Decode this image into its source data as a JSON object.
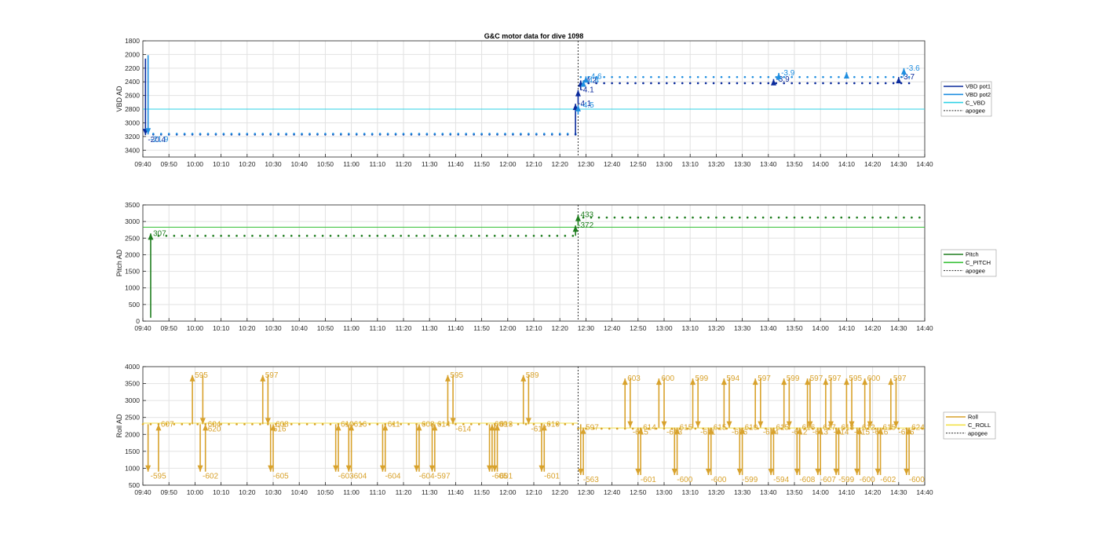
{
  "title": "G&C motor data for dive 1098",
  "colors": {
    "vbd_pot1": "#0a2a9c",
    "vbd_pot2": "#1f8ee0",
    "c_vbd": "#2ed2e6",
    "pitch": "#1e7d1e",
    "c_pitch": "#33c033",
    "roll": "#d8a22c",
    "c_roll": "#f2e24a",
    "apogee": "#333333",
    "grid": "#e2e2e2",
    "axis": "#262626"
  },
  "x_ticks": [
    "09:40",
    "09:50",
    "10:00",
    "10:10",
    "10:20",
    "10:30",
    "10:40",
    "10:50",
    "11:00",
    "11:10",
    "11:20",
    "11:30",
    "11:40",
    "11:50",
    "12:00",
    "12:10",
    "12:20",
    "12:30",
    "12:40",
    "12:50",
    "13:00",
    "13:10",
    "13:20",
    "13:30",
    "13:40",
    "13:50",
    "14:00",
    "14:10",
    "14:20",
    "14:30",
    "14:40"
  ],
  "chart_data": [
    {
      "type": "scatter",
      "title": "G&C motor data for dive 1098",
      "xlabel": "",
      "ylabel": "VBD AD",
      "xlim": [
        "09:40",
        "14:40"
      ],
      "ylim": [
        1800,
        3500
      ],
      "y_reversed": true,
      "y_ticks": [
        1800,
        2000,
        2200,
        2400,
        2600,
        2800,
        3000,
        3200,
        3400
      ],
      "grid": true,
      "legend": "right",
      "legend_entries": [
        "VBD pot1",
        "VBD pot2",
        "C_VBD",
        "apogee"
      ],
      "apogee_x": "12:27",
      "reference_lines": [
        {
          "name": "C_VBD",
          "y": 2800
        }
      ],
      "series": [
        {
          "name": "VBD pot1",
          "style": "dots",
          "x_range": [
            "09:44",
            "14:35"
          ],
          "segments": [
            {
              "from": "09:44",
              "to": "12:26",
              "y": 3170
            },
            {
              "from": "12:28",
              "to": "14:35",
              "y": 2420
            }
          ]
        },
        {
          "name": "VBD pot2",
          "style": "dots",
          "x_range": [
            "09:44",
            "14:35"
          ],
          "segments": [
            {
              "from": "09:44",
              "to": "12:26",
              "y": 3160
            },
            {
              "from": "12:28",
              "to": "14:35",
              "y": 2330
            }
          ]
        }
      ],
      "moves": [
        {
          "series": "VBD pot1",
          "x": "09:41",
          "from": 2060,
          "to": 3180,
          "label": "-20.4"
        },
        {
          "series": "VBD pot2",
          "x": "09:42",
          "from": 2010,
          "to": 3170,
          "label": "-21.9"
        },
        {
          "series": "VBD pot1",
          "x": "12:26",
          "from": 3180,
          "to": 2720,
          "label": "-4.1"
        },
        {
          "series": "VBD pot2",
          "x": "12:27",
          "from": 2880,
          "to": 2740,
          "label": "-4.5"
        },
        {
          "series": "VBD pot1",
          "x": "12:27",
          "from": 2720,
          "to": 2520,
          "label": "-4.1"
        },
        {
          "series": "VBD pot1",
          "x": "12:28",
          "from": 2520,
          "to": 2380,
          "label": "-4.2"
        },
        {
          "series": "VBD pot2",
          "x": "12:29",
          "from": 2440,
          "to": 2380,
          "label": "-4.4"
        },
        {
          "series": "VBD pot2",
          "x": "12:30",
          "from": 2380,
          "to": 2320,
          "label": "-4.6"
        },
        {
          "series": "VBD pot1",
          "x": "13:42",
          "from": 2420,
          "to": 2360,
          "label": "-3.9"
        },
        {
          "series": "VBD pot2",
          "x": "13:44",
          "from": 2380,
          "to": 2270,
          "label": "-3.9"
        },
        {
          "series": "VBD pot2",
          "x": "14:10",
          "from": 2310,
          "to": 2260,
          "label": ""
        },
        {
          "series": "VBD pot1",
          "x": "14:30",
          "from": 2400,
          "to": 2330,
          "label": "-3.7"
        },
        {
          "series": "VBD pot2",
          "x": "14:32",
          "from": 2320,
          "to": 2200,
          "label": "-3.6"
        }
      ]
    },
    {
      "type": "scatter",
      "xlabel": "",
      "ylabel": "Pitch AD",
      "xlim": [
        "09:40",
        "14:40"
      ],
      "ylim": [
        0,
        3500
      ],
      "y_ticks": [
        0,
        500,
        1000,
        1500,
        2000,
        2500,
        3000,
        3500
      ],
      "grid": true,
      "legend": "right",
      "legend_entries": [
        "Pitch",
        "C_PITCH",
        "apogee"
      ],
      "apogee_x": "12:27",
      "reference_lines": [
        {
          "name": "C_PITCH",
          "y": 2830
        }
      ],
      "series": [
        {
          "name": "Pitch",
          "style": "dots",
          "segments": [
            {
              "from": "09:43",
              "to": "12:25",
              "y": 2570
            },
            {
              "from": "12:29",
              "to": "14:40",
              "y": 3120
            }
          ]
        }
      ],
      "moves": [
        {
          "series": "Pitch",
          "x": "09:43",
          "from": 100,
          "to": 2640,
          "label": "307"
        },
        {
          "series": "Pitch",
          "x": "12:26",
          "from": 2570,
          "to": 2880,
          "label": "-372"
        },
        {
          "series": "Pitch",
          "x": "12:27",
          "from": 2880,
          "to": 3200,
          "label": "433"
        }
      ]
    },
    {
      "type": "scatter",
      "xlabel": "",
      "ylabel": "Roll AD",
      "xlim": [
        "09:40",
        "14:40"
      ],
      "ylim": [
        500,
        4000
      ],
      "y_ticks": [
        500,
        1000,
        1500,
        2000,
        2500,
        3000,
        3500,
        4000
      ],
      "grid": true,
      "legend": "right",
      "legend_entries": [
        "Roll",
        "C_ROLL",
        "apogee"
      ],
      "apogee_x": "12:27",
      "reference_lines": [
        {
          "name": "C_ROLL",
          "segments": [
            {
              "from": "09:40",
              "to": "12:27",
              "y": 2330
            },
            {
              "from": "12:27",
              "to": "14:40",
              "y": 2190
            }
          ]
        }
      ],
      "series": [
        {
          "name": "Roll",
          "style": "dots",
          "segments": [
            {
              "from": "09:40",
              "to": "12:27",
              "y": 2300
            },
            {
              "from": "12:27",
              "to": "14:40",
              "y": 2170
            }
          ]
        }
      ],
      "moves": [
        {
          "x": "09:42",
          "from": 2300,
          "to": 900,
          "label": "-595"
        },
        {
          "x": "09:46",
          "from": 900,
          "to": 2300,
          "label": "607"
        },
        {
          "x": "09:59",
          "from": 2300,
          "to": 3750,
          "label": "595"
        },
        {
          "x": "10:02",
          "from": 2300,
          "to": 900,
          "label": "-602"
        },
        {
          "x": "10:03",
          "from": 3750,
          "to": 2300,
          "label": "-620"
        },
        {
          "x": "10:04",
          "from": 900,
          "to": 2300,
          "label": "604"
        },
        {
          "x": "10:26",
          "from": 2300,
          "to": 3750,
          "label": "597"
        },
        {
          "x": "10:28",
          "from": 3750,
          "to": 2300,
          "label": "-616"
        },
        {
          "x": "10:29",
          "from": 2300,
          "to": 900,
          "label": "-605"
        },
        {
          "x": "10:30",
          "from": 900,
          "to": 2300,
          "label": "608"
        },
        {
          "x": "10:54",
          "from": 2300,
          "to": 900,
          "label": "-603"
        },
        {
          "x": "10:55",
          "from": 900,
          "to": 2300,
          "label": "610"
        },
        {
          "x": "10:59",
          "from": 2300,
          "to": 900,
          "label": "-604"
        },
        {
          "x": "11:00",
          "from": 900,
          "to": 2300,
          "label": "616"
        },
        {
          "x": "11:12",
          "from": 2300,
          "to": 900,
          "label": "-604"
        },
        {
          "x": "11:13",
          "from": 900,
          "to": 2300,
          "label": "611"
        },
        {
          "x": "11:25",
          "from": 2300,
          "to": 900,
          "label": "-604"
        },
        {
          "x": "11:26",
          "from": 900,
          "to": 2300,
          "label": "608"
        },
        {
          "x": "11:31",
          "from": 2300,
          "to": 900,
          "label": "-597"
        },
        {
          "x": "11:32",
          "from": 900,
          "to": 2300,
          "label": "614"
        },
        {
          "x": "11:37",
          "from": 2300,
          "to": 3750,
          "label": "595"
        },
        {
          "x": "11:39",
          "from": 3750,
          "to": 2300,
          "label": "-614"
        },
        {
          "x": "11:53",
          "from": 2300,
          "to": 900,
          "label": "-605"
        },
        {
          "x": "11:54",
          "from": 900,
          "to": 2300,
          "label": "609"
        },
        {
          "x": "11:55",
          "from": 2300,
          "to": 900,
          "label": "-601"
        },
        {
          "x": "11:56",
          "from": 900,
          "to": 2300,
          "label": "613"
        },
        {
          "x": "12:06",
          "from": 2300,
          "to": 3750,
          "label": "589"
        },
        {
          "x": "12:08",
          "from": 3750,
          "to": 2300,
          "label": "-617"
        },
        {
          "x": "12:13",
          "from": 2300,
          "to": 900,
          "label": "-601"
        },
        {
          "x": "12:14",
          "from": 900,
          "to": 2300,
          "label": "610"
        },
        {
          "x": "12:28",
          "from": 2300,
          "to": 800,
          "label": "-563"
        },
        {
          "x": "12:29",
          "from": 800,
          "to": 2200,
          "label": "597"
        },
        {
          "x": "12:45",
          "from": 2200,
          "to": 3650,
          "label": "603"
        },
        {
          "x": "12:47",
          "from": 3650,
          "to": 2200,
          "label": "-615"
        },
        {
          "x": "12:50",
          "from": 2200,
          "to": 800,
          "label": "-601"
        },
        {
          "x": "12:51",
          "from": 800,
          "to": 2200,
          "label": "614"
        },
        {
          "x": "12:58",
          "from": 2200,
          "to": 3650,
          "label": "600"
        },
        {
          "x": "13:00",
          "from": 3650,
          "to": 2200,
          "label": "-613"
        },
        {
          "x": "13:04",
          "from": 2200,
          "to": 800,
          "label": "-600"
        },
        {
          "x": "13:05",
          "from": 800,
          "to": 2200,
          "label": "615"
        },
        {
          "x": "13:11",
          "from": 2200,
          "to": 3650,
          "label": "599"
        },
        {
          "x": "13:13",
          "from": 3650,
          "to": 2200,
          "label": "-611"
        },
        {
          "x": "13:17",
          "from": 2200,
          "to": 800,
          "label": "-600"
        },
        {
          "x": "13:18",
          "from": 800,
          "to": 2200,
          "label": "615"
        },
        {
          "x": "13:23",
          "from": 2200,
          "to": 3650,
          "label": "594"
        },
        {
          "x": "13:25",
          "from": 3650,
          "to": 2200,
          "label": "-616"
        },
        {
          "x": "13:29",
          "from": 2200,
          "to": 800,
          "label": "-599"
        },
        {
          "x": "13:30",
          "from": 800,
          "to": 2200,
          "label": "619"
        },
        {
          "x": "13:35",
          "from": 2200,
          "to": 3650,
          "label": "597"
        },
        {
          "x": "13:37",
          "from": 3650,
          "to": 2200,
          "label": "-614"
        },
        {
          "x": "13:41",
          "from": 2200,
          "to": 800,
          "label": "-594"
        },
        {
          "x": "13:42",
          "from": 800,
          "to": 2200,
          "label": "615"
        },
        {
          "x": "13:46",
          "from": 2200,
          "to": 3650,
          "label": "599"
        },
        {
          "x": "13:48",
          "from": 3650,
          "to": 2200,
          "label": "-612"
        },
        {
          "x": "13:51",
          "from": 2200,
          "to": 800,
          "label": "-608"
        },
        {
          "x": "13:52",
          "from": 800,
          "to": 2200,
          "label": "616"
        },
        {
          "x": "13:55",
          "from": 2200,
          "to": 3650,
          "label": "597"
        },
        {
          "x": "13:56",
          "from": 3650,
          "to": 2200,
          "label": "-613"
        },
        {
          "x": "13:59",
          "from": 2200,
          "to": 800,
          "label": "-607"
        },
        {
          "x": "14:00",
          "from": 800,
          "to": 2200,
          "label": "617"
        },
        {
          "x": "14:02",
          "from": 2200,
          "to": 3650,
          "label": "597"
        },
        {
          "x": "14:04",
          "from": 3650,
          "to": 2200,
          "label": "-614"
        },
        {
          "x": "14:06",
          "from": 2200,
          "to": 800,
          "label": "-599"
        },
        {
          "x": "14:07",
          "from": 800,
          "to": 2200,
          "label": "618"
        },
        {
          "x": "14:10",
          "from": 2200,
          "to": 3650,
          "label": "595"
        },
        {
          "x": "14:12",
          "from": 3650,
          "to": 2200,
          "label": "-615"
        },
        {
          "x": "14:14",
          "from": 2200,
          "to": 800,
          "label": "-600"
        },
        {
          "x": "14:15",
          "from": 800,
          "to": 2200,
          "label": "612"
        },
        {
          "x": "14:17",
          "from": 2200,
          "to": 3650,
          "label": "600"
        },
        {
          "x": "14:19",
          "from": 3650,
          "to": 2200,
          "label": "-616"
        },
        {
          "x": "14:22",
          "from": 2200,
          "to": 800,
          "label": "-602"
        },
        {
          "x": "14:23",
          "from": 800,
          "to": 2200,
          "label": "615"
        },
        {
          "x": "14:27",
          "from": 2200,
          "to": 3650,
          "label": "597"
        },
        {
          "x": "14:29",
          "from": 3650,
          "to": 2200,
          "label": "-616"
        },
        {
          "x": "14:33",
          "from": 2200,
          "to": 800,
          "label": "-600"
        },
        {
          "x": "14:34",
          "from": 800,
          "to": 2200,
          "label": "624"
        }
      ]
    }
  ]
}
